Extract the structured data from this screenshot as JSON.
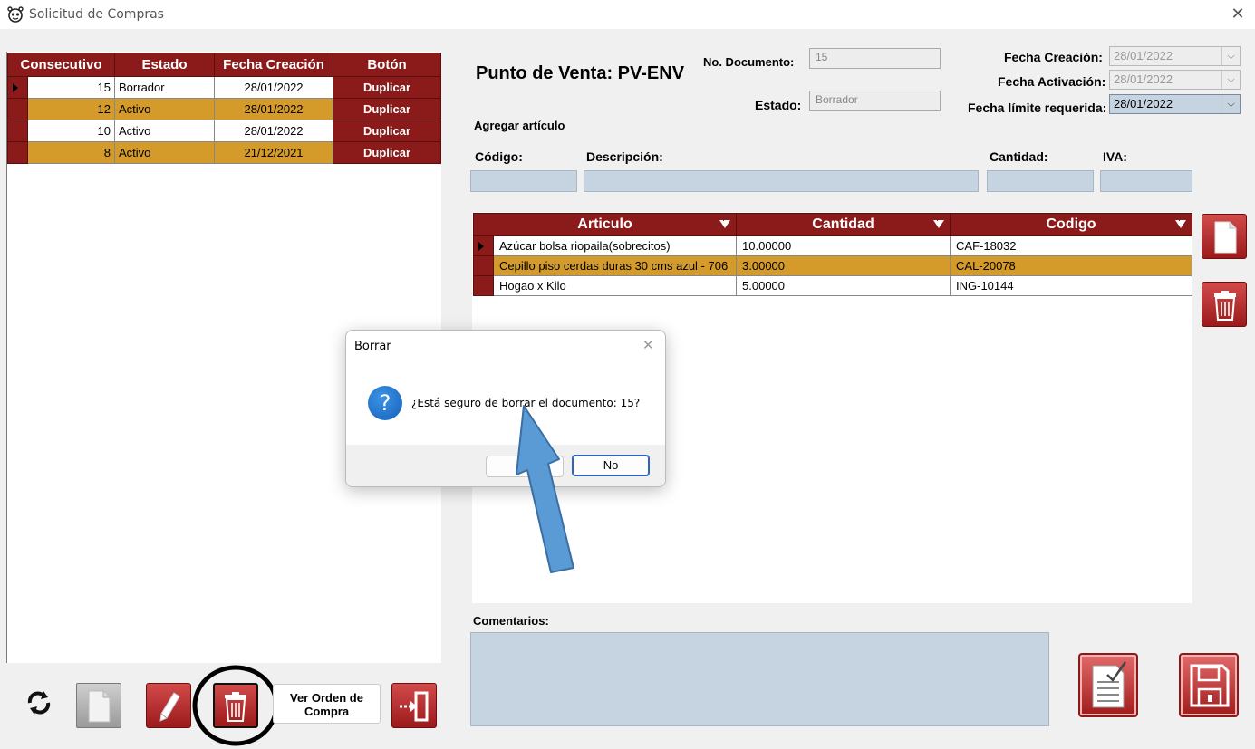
{
  "window": {
    "title": "Solicitud de Compras",
    "close_glyph": "✕",
    "icon": "app-icon"
  },
  "doc_grid": {
    "headers": [
      "Consecutivo",
      "Estado",
      "Fecha Creación",
      "Botón"
    ],
    "rows": [
      {
        "consecutivo": "15",
        "estado": "Borrador",
        "fecha": "28/01/2022",
        "boton": "Duplicar"
      },
      {
        "consecutivo": "12",
        "estado": "Activo",
        "fecha": "28/01/2022",
        "boton": "Duplicar"
      },
      {
        "consecutivo": "10",
        "estado": "Activo",
        "fecha": "28/01/2022",
        "boton": "Duplicar"
      },
      {
        "consecutivo": "8",
        "estado": "Activo",
        "fecha": "21/12/2021",
        "boton": "Duplicar"
      }
    ]
  },
  "header": {
    "punto_venta": "Punto de Venta: PV-ENV",
    "no_documento_label": "No. Documento:",
    "no_documento_value": "15",
    "estado_label": "Estado:",
    "estado_value": "Borrador",
    "fecha_creacion_label": "Fecha Creación:",
    "fecha_creacion_value": "28/01/2022",
    "fecha_activacion_label": "Fecha Activación:",
    "fecha_activacion_value": "28/01/2022",
    "fecha_limite_label": "Fecha límite requerida:",
    "fecha_limite_value": "28/01/2022"
  },
  "add_article": {
    "title": "Agregar artículo",
    "codigo_label": "Código:",
    "descripcion_label": "Descripción:",
    "cantidad_label": "Cantidad:",
    "iva_label": "IVA:"
  },
  "articles": {
    "headers": [
      "Articulo",
      "Cantidad",
      "Codigo"
    ],
    "rows": [
      {
        "articulo": "Azúcar bolsa riopaila(sobrecitos)",
        "cantidad": "10.00000",
        "codigo": "CAF-18032"
      },
      {
        "articulo": "Cepillo piso cerdas duras 30 cms azul - 706",
        "cantidad": "3.00000",
        "codigo": "CAL-20078"
      },
      {
        "articulo": "Hogao x Kilo",
        "cantidad": "5.00000",
        "codigo": "ING-10144"
      }
    ]
  },
  "comentarios_label": "Comentarios:",
  "toolbar": {
    "ver_orden_label_1": "Ver Orden de",
    "ver_orden_label_2": "Compra"
  },
  "dialog": {
    "title": "Borrar",
    "message": "¿Está seguro de borrar el documento: 15?",
    "yes_label": "",
    "no_label": "No",
    "icon": "question-icon"
  },
  "colors": {
    "header_red": "#8b1a1a",
    "alt_row": "#d49a2a",
    "field_blue": "#c6d3e0",
    "arrow_blue": "#5b9bd5"
  }
}
